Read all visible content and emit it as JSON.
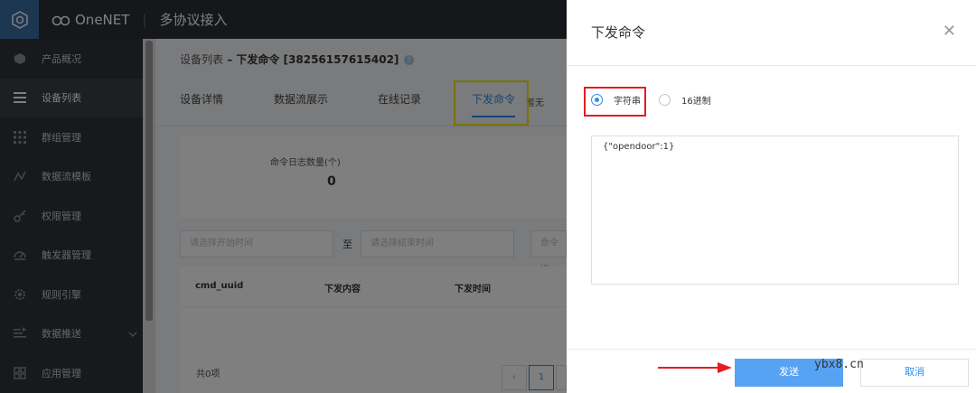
{
  "topbar": {
    "brand": "OneNET",
    "module": "多协议接入"
  },
  "sidebar": {
    "items": [
      {
        "label": "产品概况",
        "icon": "cube-icon"
      },
      {
        "label": "设备列表",
        "icon": "list-icon"
      },
      {
        "label": "群组管理",
        "icon": "grid-icon"
      },
      {
        "label": "数据流模板",
        "icon": "chart-icon"
      },
      {
        "label": "权限管理",
        "icon": "key-icon"
      },
      {
        "label": "触发器管理",
        "icon": "gauge-icon"
      },
      {
        "label": "规则引擎",
        "icon": "gear-icon"
      },
      {
        "label": "数据推送",
        "icon": "push-icon"
      },
      {
        "label": "应用管理",
        "icon": "apps-icon"
      }
    ]
  },
  "main": {
    "breadcrumb_root": "设备列表",
    "breadcrumb_sep": " – ",
    "breadcrumb_current": "下发命令 [38256157615402]",
    "tabs": [
      "设备详情",
      "数据流展示",
      "在线记录",
      "下发命令"
    ],
    "stat_label": "命令日志数量(个)",
    "stat_value": "0",
    "filter_start": "请选择开始时间",
    "filter_to": "至",
    "filter_end": "请选择结束时间",
    "filter_cmd": "命令ID",
    "columns": [
      "cmd_uuid",
      "下发内容",
      "下发时间"
    ],
    "empty": "暂无",
    "total": "共0项",
    "page": "1"
  },
  "drawer": {
    "title": "下发命令",
    "radio_string": "字符串",
    "radio_hex": "16进制",
    "command": "{\"opendoor\":1}",
    "send": "发送",
    "cancel": "取消"
  },
  "watermark": "ybx8.cn"
}
